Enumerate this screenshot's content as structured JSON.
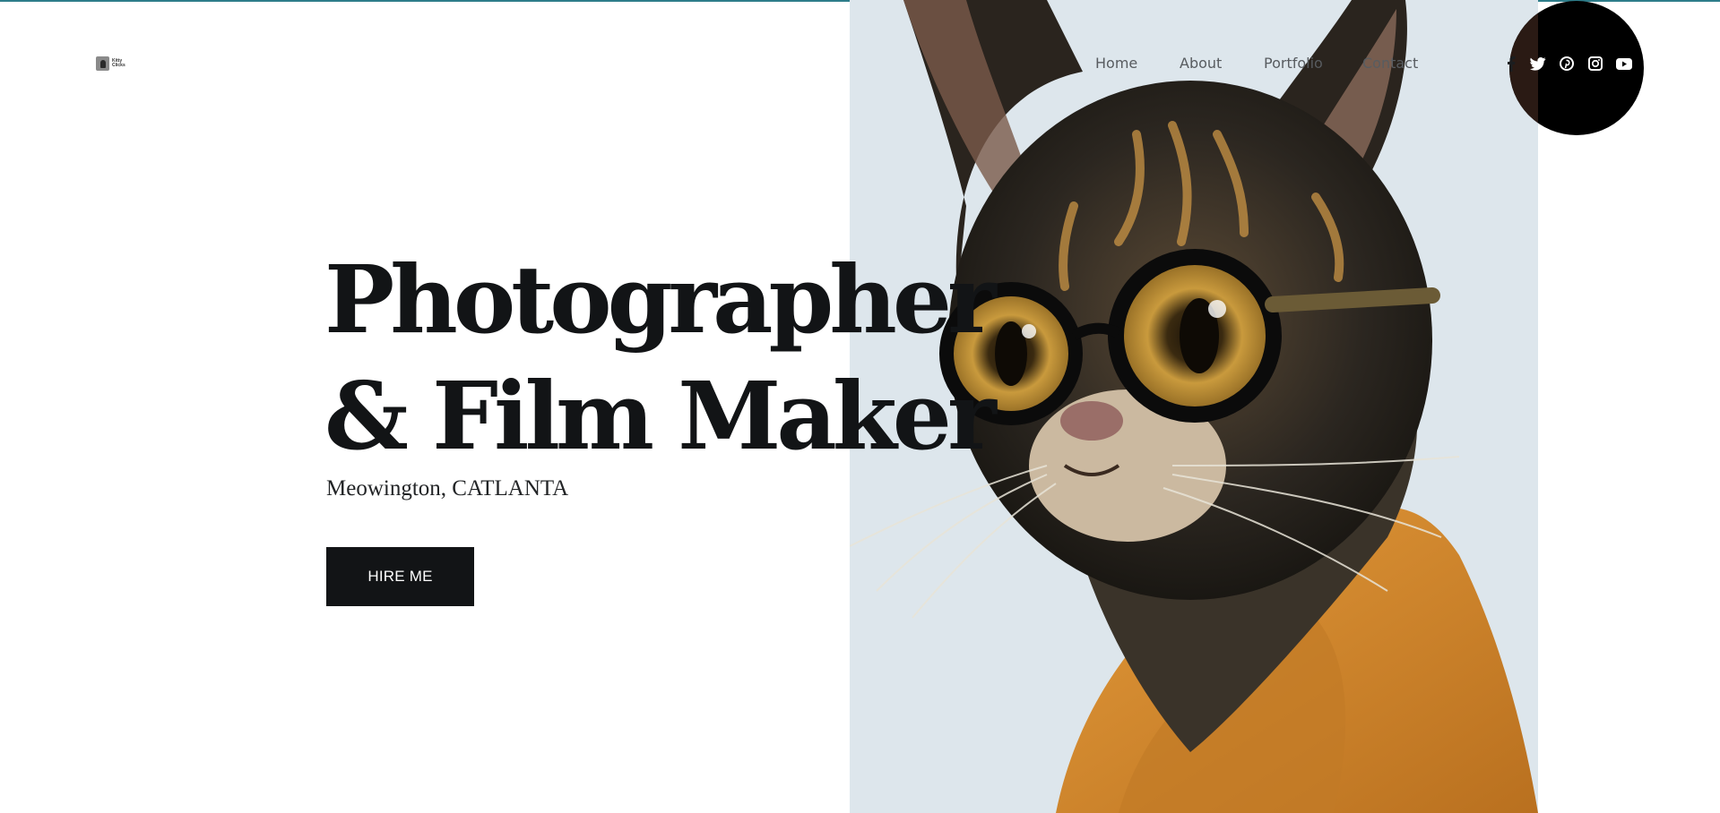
{
  "header": {
    "logo": {
      "text": "Kitty\nClicks"
    },
    "nav": {
      "home": "Home",
      "about": "About",
      "portfolio": "Portfolio",
      "contact": "Contact"
    },
    "social": [
      "facebook-icon",
      "twitter-icon",
      "pinterest-icon",
      "instagram-icon",
      "youtube-icon"
    ]
  },
  "hero": {
    "headline_line1": "Photographer",
    "headline_line2": "& Film Maker",
    "location": "Meowington, CATLANTA",
    "cta_label": "HIRE ME",
    "image_icon": "cat-with-glasses-photo"
  },
  "colors": {
    "accent_rule": "#2e7d8a",
    "panel_bg": "#dde6ec",
    "text_dark": "#121416",
    "button_bg": "#121416",
    "hoodie": "#d48a2e"
  }
}
